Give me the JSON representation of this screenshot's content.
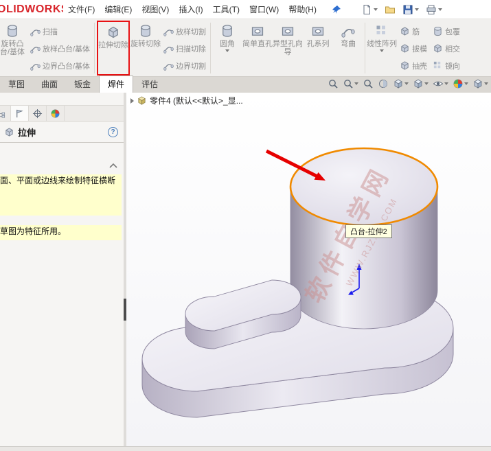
{
  "menu_bar": {
    "logo": "OLIDWORKS",
    "items": [
      {
        "label": "文件(F)"
      },
      {
        "label": "编辑(E)"
      },
      {
        "label": "视图(V)"
      },
      {
        "label": "插入(I)"
      },
      {
        "label": "工具(T)"
      },
      {
        "label": "窗口(W)"
      },
      {
        "label": "帮助(H)"
      }
    ],
    "quick_access_icons": [
      "new-document",
      "open",
      "save",
      "print"
    ],
    "pin_icon": "pin"
  },
  "ribbon": {
    "g1_large": {
      "label": "旋转凸台/基体"
    },
    "g1_small": [
      {
        "label": "扫描"
      },
      {
        "label": "放样凸台/基体"
      },
      {
        "label": "边界凸台/基体"
      }
    ],
    "g2_large": [
      {
        "label": "拉伸切除",
        "highlighted": true
      },
      {
        "label": "旋转切除"
      }
    ],
    "g2_small": [
      {
        "label": "放样切割"
      },
      {
        "label": "扫描切除"
      },
      {
        "label": "边界切割"
      }
    ],
    "g3_large": {
      "label": "圆角"
    },
    "g3_vertical": [
      {
        "label": "简单直孔"
      },
      {
        "label": "异型孔向导"
      },
      {
        "label": "孔系列"
      },
      {
        "label": "弯曲"
      }
    ],
    "g4_large": {
      "label": "线性阵列"
    },
    "g4_small_a": [
      {
        "label": "筋"
      },
      {
        "label": "拔模"
      },
      {
        "label": "抽壳"
      }
    ],
    "g4_small_b": [
      {
        "label": "包覆"
      },
      {
        "label": "相交"
      },
      {
        "label": "镜向"
      }
    ],
    "highlight_color": "#e81113"
  },
  "tabs": [
    {
      "label": "草图"
    },
    {
      "label": "曲面"
    },
    {
      "label": "钣金"
    },
    {
      "label": "焊件",
      "active": true
    },
    {
      "label": "评估"
    }
  ],
  "heads_up_toolbar": {
    "icons": [
      "zoom-fit",
      "zoom-to-area",
      "previous-view",
      "section-view",
      "view-orientation",
      "display-style",
      "hide-show-items",
      "edit-appearance",
      "view-settings"
    ]
  },
  "property_panel": {
    "tabs": [
      "feature-manager",
      "property-manager",
      "configuration-manager",
      "display-manager"
    ],
    "title": "拉伸",
    "help": "?",
    "message_primary": "面、平面或边线来绘制特征横断",
    "message_secondary": "草图为特征所用。"
  },
  "viewport": {
    "breadcrumb": "零件4 (默认<<默认>_显...",
    "tooltip": "凸台-拉伸2",
    "watermark_main": "软件自学网",
    "watermark_sub": "WWW.RJZXW.COM"
  },
  "colors": {
    "selection_rim": "#f08a00",
    "annotation_arrow": "#e60000",
    "origin_axis": "#1a1aee",
    "message_bg": "#ffffcc",
    "tooltip_bg": "#ffffe1"
  }
}
